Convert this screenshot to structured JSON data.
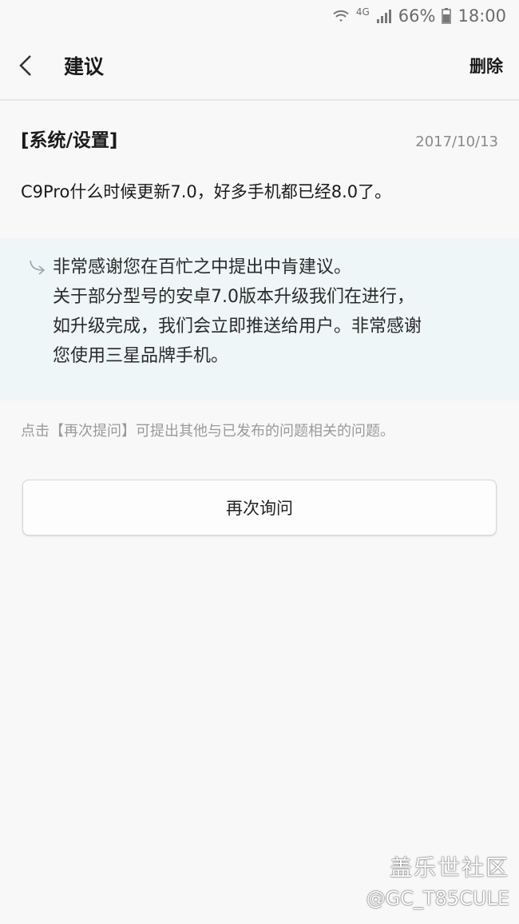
{
  "status_bar": {
    "network": "4G",
    "battery": "66%",
    "time": "18:00",
    "icons": [
      "wifi-icon",
      "signal-icon",
      "battery-icon"
    ]
  },
  "app_bar": {
    "title": "建议",
    "action_label": "删除",
    "back_icon": "back-arrow-icon"
  },
  "question": {
    "category": "[系统/设置]",
    "date": "2017/10/13",
    "text": "C9Pro什么时候更新7.0，好多手机都已经8.0了。"
  },
  "answer": {
    "icon": "reply-arrow-icon",
    "lines": [
      "非常感谢您在百忙之中提出中肯建议。",
      "关于部分型号的安卓7.0版本升级我们在进行，",
      "如升级完成，我们会立即推送给用户。非常感谢",
      "您使用三星品牌手机。"
    ]
  },
  "hint": "点击【再次提问】可提出其他与已发布的问题相关的问题。",
  "ask_again_label": "再次询问",
  "watermark": {
    "line1": "盖乐世社区",
    "line2": "@GC_T85CULE"
  },
  "colors": {
    "background": "#f8f8f8",
    "answer_background": "#eef6f7",
    "secondary_text": "#8a8a8a"
  }
}
